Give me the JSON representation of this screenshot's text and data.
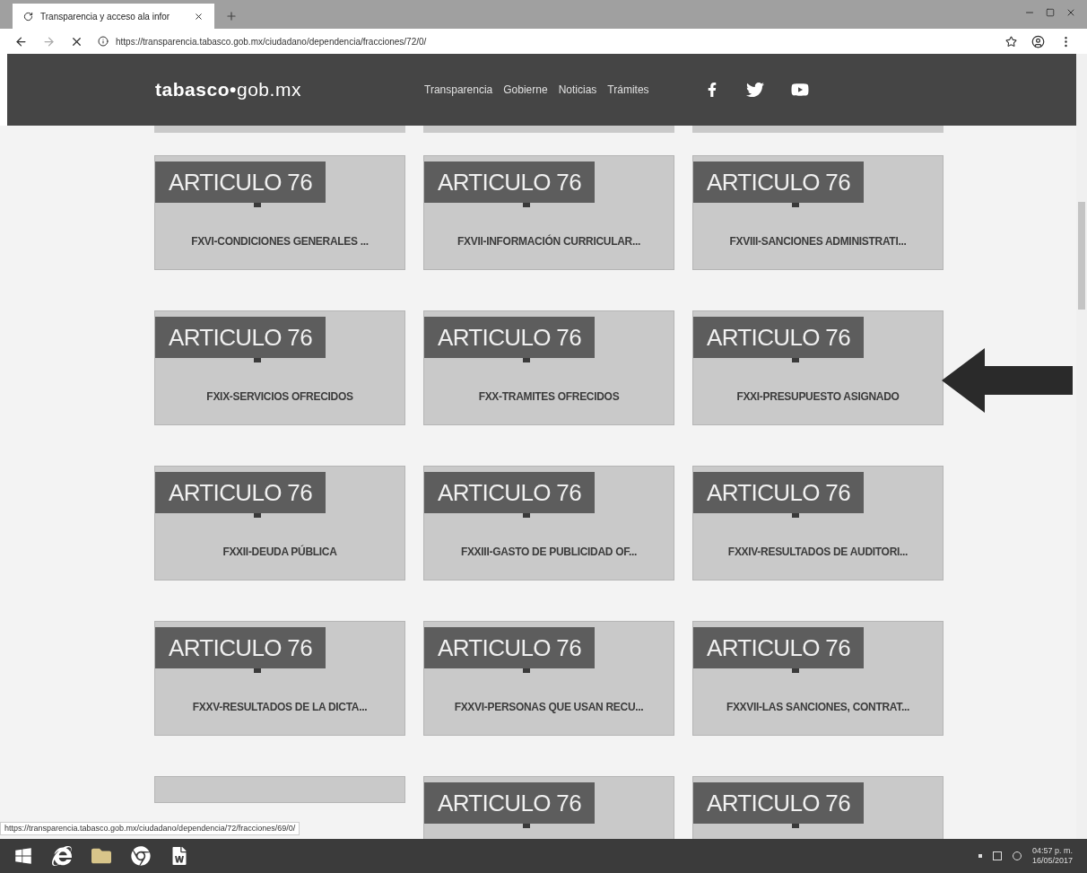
{
  "browser": {
    "tab_title": "Transparencia y acceso ala infor",
    "url": "https://transparencia.tabasco.gob.mx/ciudadano/dependencia/fracciones/72/0/",
    "status_url": "https://transparencia.tabasco.gob.mx/ciudadano/dependencia/72/fracciones/69/0/"
  },
  "site": {
    "logo": "**tabasco•**gob.mx",
    "nav": [
      "Transparencia",
      "Gobierne",
      "Noticias",
      "Trámites"
    ]
  },
  "cards": [
    {
      "kind": "fraction",
      "heading": "ARTICULO 76",
      "label": "FXVI-CONDICIONES GENERALES ..."
    },
    {
      "kind": "fraction",
      "heading": "ARTICULO 76",
      "label": "FXVII-INFORMACIÓN CURRICULAR..."
    },
    {
      "kind": "fraction",
      "heading": "ARTICULO 76",
      "label": "FXVIII-SANCIONES ADMINISTRATI..."
    },
    {
      "kind": "fraction",
      "heading": "ARTICULO 76",
      "label": "FXIX-SERVICIOS OFRECIDOS"
    },
    {
      "kind": "fraction",
      "heading": "ARTICULO 76",
      "label": "FXX-TRAMITES OFRECIDOS"
    },
    {
      "kind": "fraction",
      "heading": "ARTICULO 76",
      "label": "FXXI-PRESUPUESTO ASIGNADO"
    },
    {
      "kind": "fraction",
      "heading": "ARTICULO 76",
      "label": "FXXII-DEUDA PÚBLICA"
    },
    {
      "kind": "fraction",
      "heading": "ARTICULO 76",
      "label": "FXXIII-GASTO DE PUBLICIDAD OF..."
    },
    {
      "kind": "fraction",
      "heading": "ARTICULO 76",
      "label": "FXXIV-RESULTADOS DE AUDITORI..."
    },
    {
      "kind": "fraction",
      "heading": "ARTICULO 76",
      "label": "FXXV-RESULTADOS DE LA DICTA..."
    },
    {
      "kind": "fraction",
      "heading": "ARTICULO 76",
      "label": "FXXVI-PERSONAS QUE USAN RECU..."
    },
    {
      "kind": "fraction",
      "heading": "ARTICULO 76",
      "label": "FXXVII-LAS SANCIONES, CONTRAT..."
    },
    {
      "kind": "covered"
    },
    {
      "kind": "fraction",
      "heading": "ARTICULO 76"
    },
    {
      "kind": "fraction",
      "heading": "ARTICULO 76"
    }
  ],
  "clock": {
    "time": "04:57 p. m.",
    "date": "16/05/2017"
  }
}
